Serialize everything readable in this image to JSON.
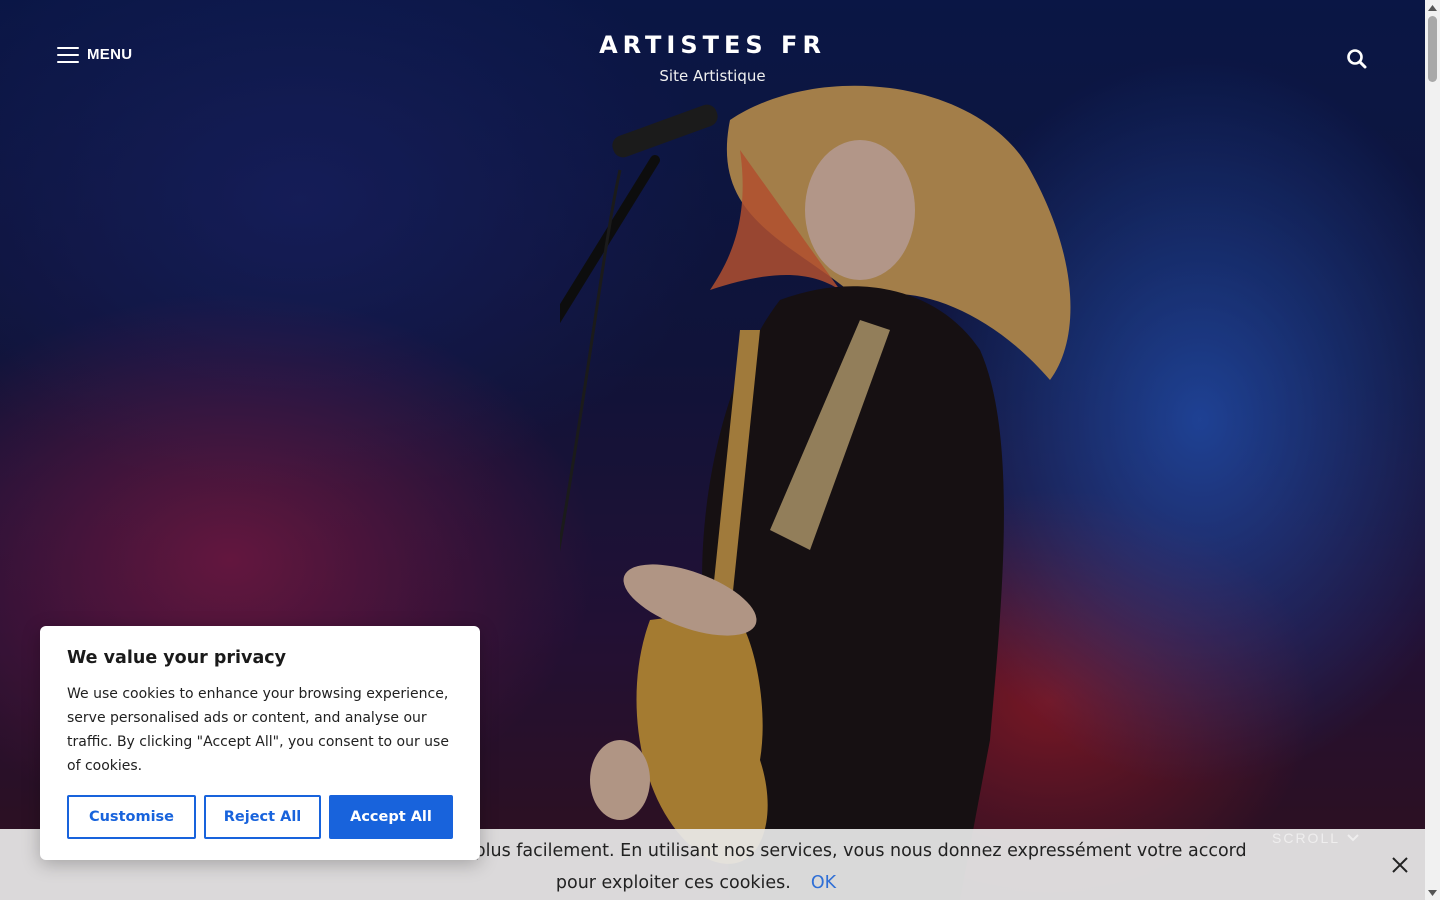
{
  "header": {
    "menu_label": "MENU",
    "site_title": "ARTISTES FR",
    "site_tagline": "Site Artistique",
    "search_icon": "search-icon",
    "menu_icon": "hamburger-icon"
  },
  "hero": {
    "scroll_label": "SCROLL",
    "scroll_icon": "chevron-down-icon"
  },
  "notice_bar": {
    "text_line1": "Le                                       s services plus facilement. En utilisant nos services, vous nous donnez expressément votre accord",
    "text_line2": "pour exploiter ces cookies.",
    "ok_label": "OK",
    "close_icon": "close-icon"
  },
  "consent": {
    "title": "We value your privacy",
    "body": "We use cookies to enhance your browsing experience, serve personalised ads or content, and analyse our traffic. By clicking \"Accept All\", you consent to our use of cookies.",
    "customise_label": "Customise",
    "reject_label": "Reject All",
    "accept_label": "Accept All"
  },
  "colors": {
    "accent": "#1863dc",
    "notice_link": "#2f6fd6"
  }
}
